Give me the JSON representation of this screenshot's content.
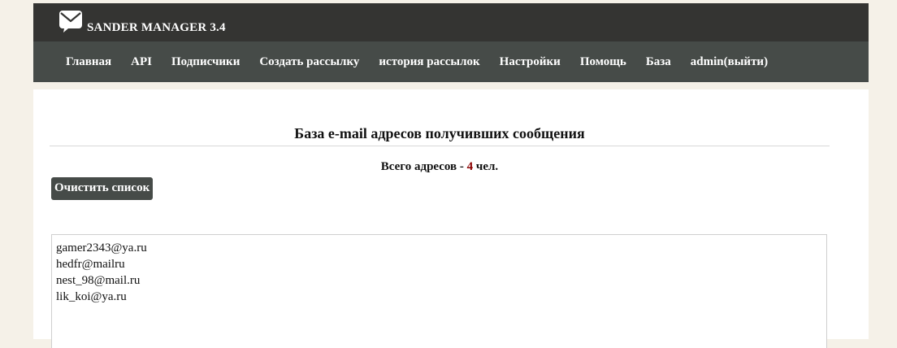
{
  "app": {
    "title": "SANDER MANAGER 3.4",
    "logo_icon": "envelope-icon"
  },
  "nav": {
    "items": [
      {
        "label": "Главная"
      },
      {
        "label": "API"
      },
      {
        "label": "Подписчики"
      },
      {
        "label": "Создать рассылку"
      },
      {
        "label": "история рассылок"
      },
      {
        "label": "Настройки"
      },
      {
        "label": "Помощь"
      },
      {
        "label": "База"
      },
      {
        "label": "admin(выйти)"
      }
    ]
  },
  "main": {
    "title": "База e-mail адресов получивших сообщения",
    "count_prefix": "Всего адресов - ",
    "count_value": "4",
    "count_suffix": " чел.",
    "clear_button": "Очистить список",
    "emails": [
      "gamer2343@ya.ru",
      "hedfr@mailru",
      "nest_98@mail.ru",
      "lik_koi@ya.ru"
    ]
  },
  "colors": {
    "header_bg": "#343432",
    "nav_bg": "#464b48",
    "count_accent": "#8b0000",
    "page_bg": "#f5f1e8"
  }
}
